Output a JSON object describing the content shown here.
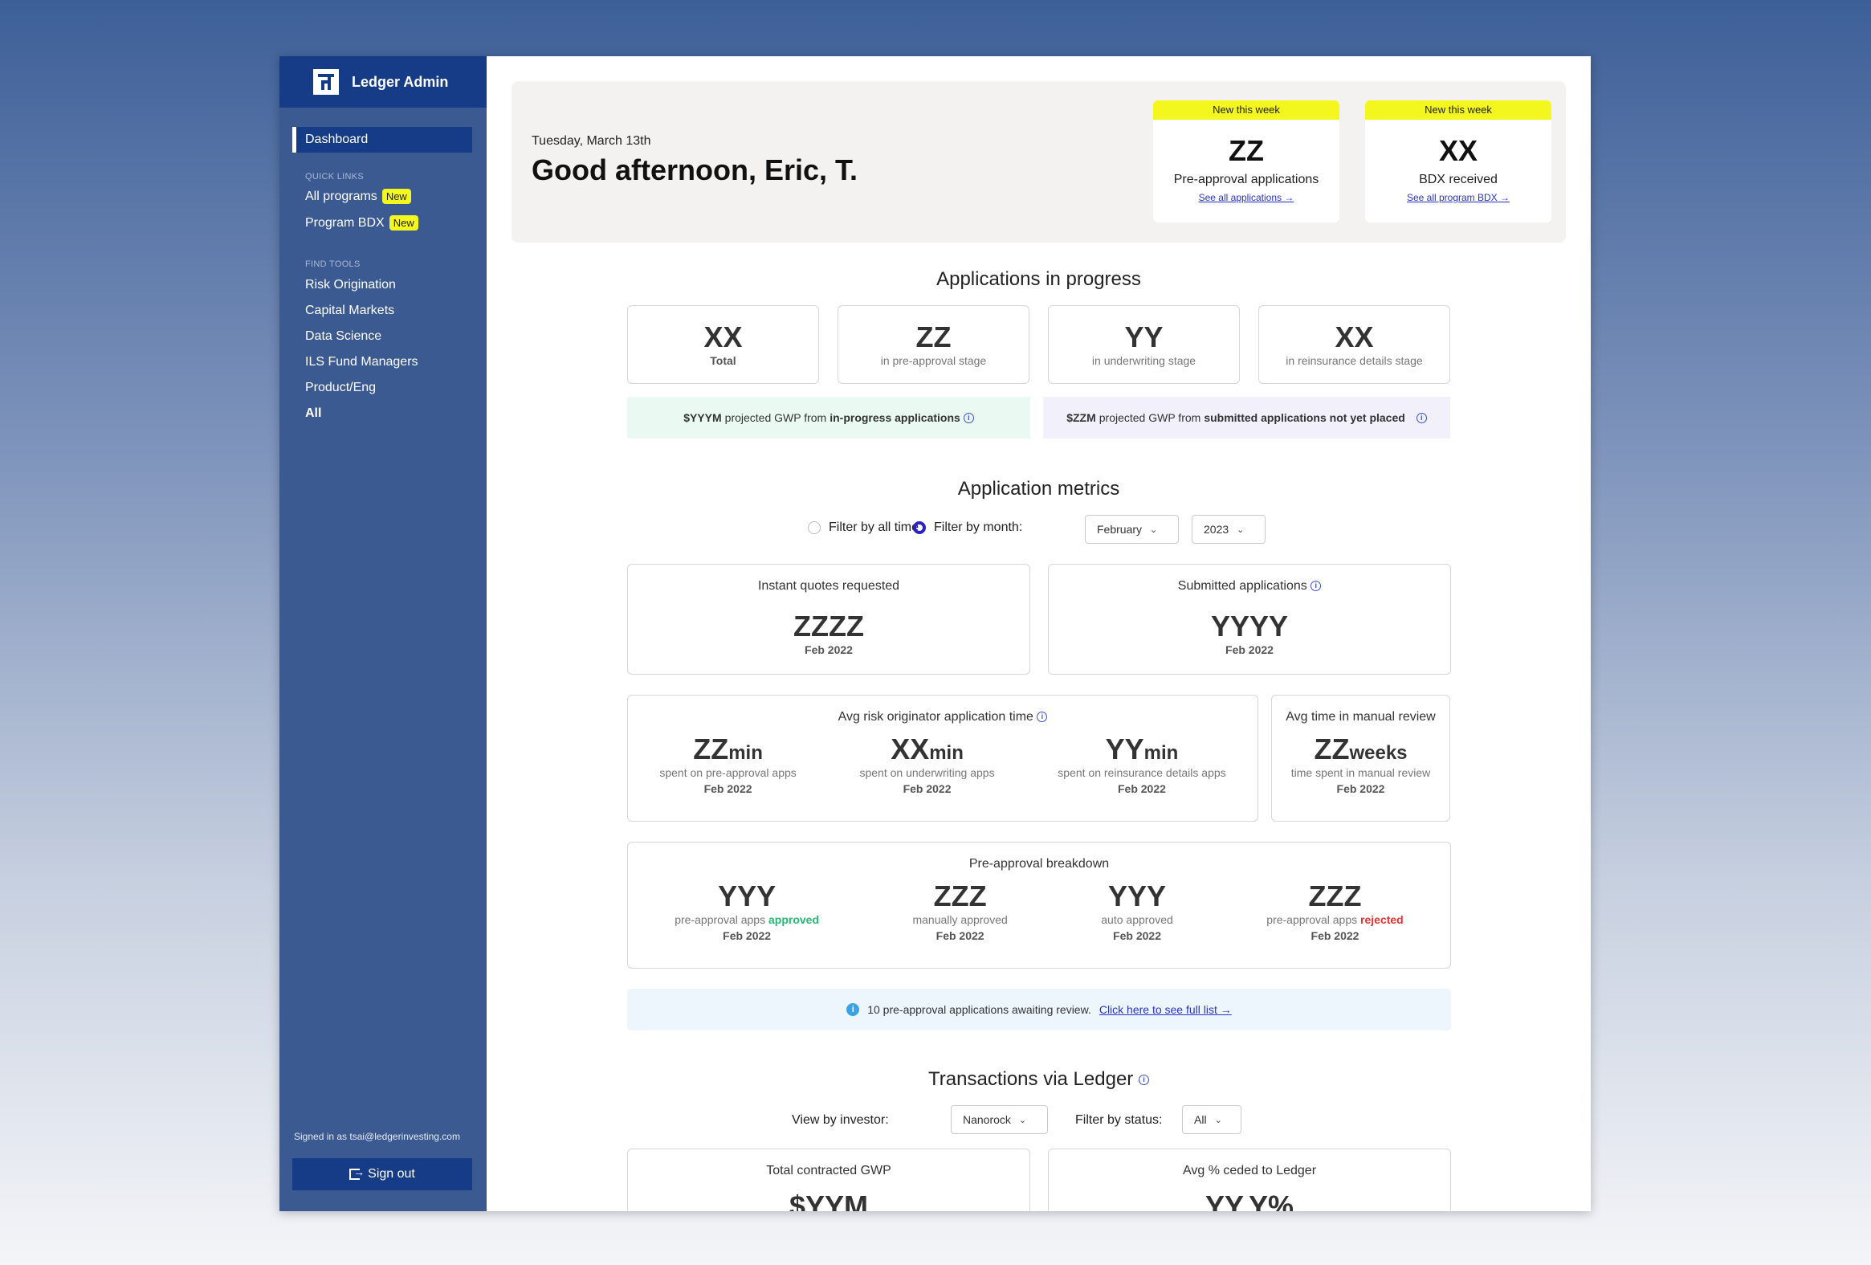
{
  "sidebar": {
    "brand": "Ledger Admin",
    "active": "Dashboard",
    "quick_links_label": "QUICK LINKS",
    "quick_links": [
      {
        "label": "All programs",
        "badge": "New"
      },
      {
        "label": "Program BDX",
        "badge": "New"
      }
    ],
    "find_tools_label": "FIND TOOLS",
    "tools": [
      "Risk Origination",
      "Capital Markets",
      "Data Science",
      "ILS Fund Managers",
      "Product/Eng",
      "All"
    ],
    "signed_in": "Signed in as tsai@ledgerinvesting.com",
    "sign_out": "Sign out"
  },
  "hero": {
    "date": "Tuesday, March 13th",
    "greeting": "Good afternoon, Eric, T.",
    "cards": [
      {
        "tag": "New this week",
        "value": "ZZ",
        "label": "Pre-approval applications",
        "link": "See all applications →"
      },
      {
        "tag": "New this week",
        "value": "XX",
        "label": "BDX received",
        "link": "See all program BDX →"
      }
    ]
  },
  "progress": {
    "title": "Applications in progress",
    "stats": [
      {
        "value": "XX",
        "label": "Total"
      },
      {
        "value": "ZZ",
        "label": "in pre-approval stage"
      },
      {
        "value": "YY",
        "label": "in underwriting stage"
      },
      {
        "value": "XX",
        "label": "in reinsurance details stage"
      }
    ],
    "gwp_left": {
      "amount": "$YYYM",
      "mid": "projected GWP from",
      "bold": "in-progress applications",
      "color": "#eafaf3"
    },
    "gwp_right": {
      "amount": "$ZZM",
      "mid": "projected GWP from",
      "bold": "submitted applications not yet placed",
      "color": "#f1f0fb"
    }
  },
  "metrics": {
    "title": "Application metrics",
    "filter_all": "Filter by all time",
    "filter_month": "Filter by month:",
    "month": "February",
    "year": "2023",
    "instant": {
      "title": "Instant quotes requested",
      "value": "ZZZZ",
      "period": "Feb 2022"
    },
    "submitted": {
      "title": "Submitted applications",
      "value": "YYYY",
      "period": "Feb 2022"
    },
    "avg_time": {
      "title": "Avg risk originator application time",
      "items": [
        {
          "value": "ZZ",
          "unit": "min",
          "label": "spent on pre-approval apps",
          "period": "Feb 2022"
        },
        {
          "value": "XX",
          "unit": "min",
          "label": "spent on underwriting apps",
          "period": "Feb 2022"
        },
        {
          "value": "YY",
          "unit": "min",
          "label": "spent on reinsurance details apps",
          "period": "Feb 2022"
        }
      ]
    },
    "manual": {
      "title": "Avg time in manual review",
      "value": "ZZ",
      "unit": "weeks",
      "label": "time spent in manual review",
      "period": "Feb 2022"
    },
    "breakdown": {
      "title": "Pre-approval breakdown",
      "items": [
        {
          "value": "YYY",
          "label": "pre-approval apps",
          "highlight": "approved",
          "period": "Feb 2022"
        },
        {
          "value": "ZZZ",
          "label": "manually approved",
          "highlight": "",
          "period": "Feb 2022"
        },
        {
          "value": "YYY",
          "label": "auto approved",
          "highlight": "",
          "period": "Feb 2022"
        },
        {
          "value": "ZZZ",
          "label": "pre-approval apps",
          "highlight": "rejected",
          "period": "Feb 2022"
        }
      ]
    },
    "alert": {
      "text": "10 pre-approval applications awaiting review.",
      "link": "Click here to see full list →"
    }
  },
  "transactions": {
    "title": "Transactions via Ledger",
    "investor_label": "View by investor:",
    "investor": "Nanorock",
    "status_label": "Filter by status:",
    "status": "All",
    "gwp": {
      "title": "Total contracted GWP",
      "value": "$YYM"
    },
    "ceded": {
      "title": "Avg % ceded to Ledger",
      "value": "YY.Y%"
    }
  }
}
